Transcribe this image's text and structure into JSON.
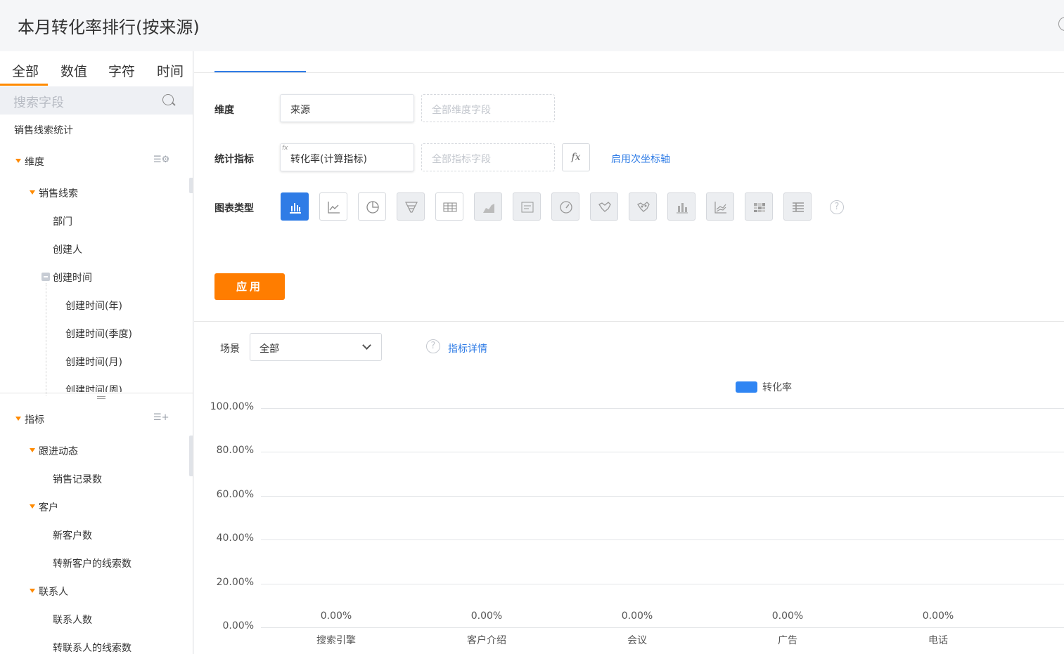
{
  "window": {
    "title": "本月转化率排行(按来源)"
  },
  "left": {
    "tabs": [
      "全部",
      "数值",
      "字符",
      "时间"
    ],
    "search_placeholder": "搜索字段",
    "dataset": "销售线索统计",
    "dimension_section": "维度",
    "dimension_groups": [
      {
        "label": "销售线索",
        "items": [
          "部门",
          "创建人"
        ]
      }
    ],
    "date_group": {
      "label": "创建时间",
      "children": [
        "创建时间(年)",
        "创建时间(季度)",
        "创建时间(月)",
        "创建时间(周)"
      ]
    },
    "metric_section": "指标",
    "metric_groups": [
      {
        "label": "跟进动态",
        "items": [
          "销售记录数"
        ]
      },
      {
        "label": "客户",
        "items": [
          "新客户数",
          "转新客户的线索数"
        ]
      },
      {
        "label": "联系人",
        "items": [
          "联系人数",
          "转联系人的线索数"
        ]
      }
    ]
  },
  "config": {
    "dimension_label": "维度",
    "dimension_value": "来源",
    "dimension_placeholder": "全部维度字段",
    "metric_label": "统计指标",
    "metric_value": "转化率(计算指标)",
    "metric_fx_tag": "fx",
    "metric_placeholder": "全部指标字段",
    "fx_button": "fx",
    "secondary_axis_link": "启用次坐标轴",
    "chart_type_label": "图表类型",
    "chart_types": [
      "bar",
      "line",
      "pie",
      "funnel",
      "table",
      "area",
      "text",
      "gauge",
      "map",
      "scatter-map",
      "stacked-bar",
      "stacked-line",
      "heatmap",
      "pivot"
    ],
    "selected_chart_type": "bar",
    "help_icon": "?",
    "apply_button": "应用"
  },
  "filter": {
    "scene_label": "场景",
    "scene_value": "全部",
    "help_icon": "?",
    "metric_detail_link": "指标详情"
  },
  "colors": {
    "accent": "#ff7d00",
    "primary": "#2f7ce6",
    "series": "#2f85f3"
  },
  "chart_data": {
    "type": "bar",
    "categories": [
      "搜索引擎",
      "客户介绍",
      "会议",
      "广告",
      "电话"
    ],
    "series": [
      {
        "name": "转化率",
        "values": [
          0,
          0,
          0,
          0,
          0
        ]
      }
    ],
    "data_labels": [
      "0.00%",
      "0.00%",
      "0.00%",
      "0.00%",
      "0.00%"
    ],
    "y_ticks": [
      "0.00%",
      "20.00%",
      "40.00%",
      "60.00%",
      "80.00%",
      "100.00%"
    ],
    "ylim": [
      0,
      100
    ],
    "grid": true,
    "legend": "top-center"
  }
}
